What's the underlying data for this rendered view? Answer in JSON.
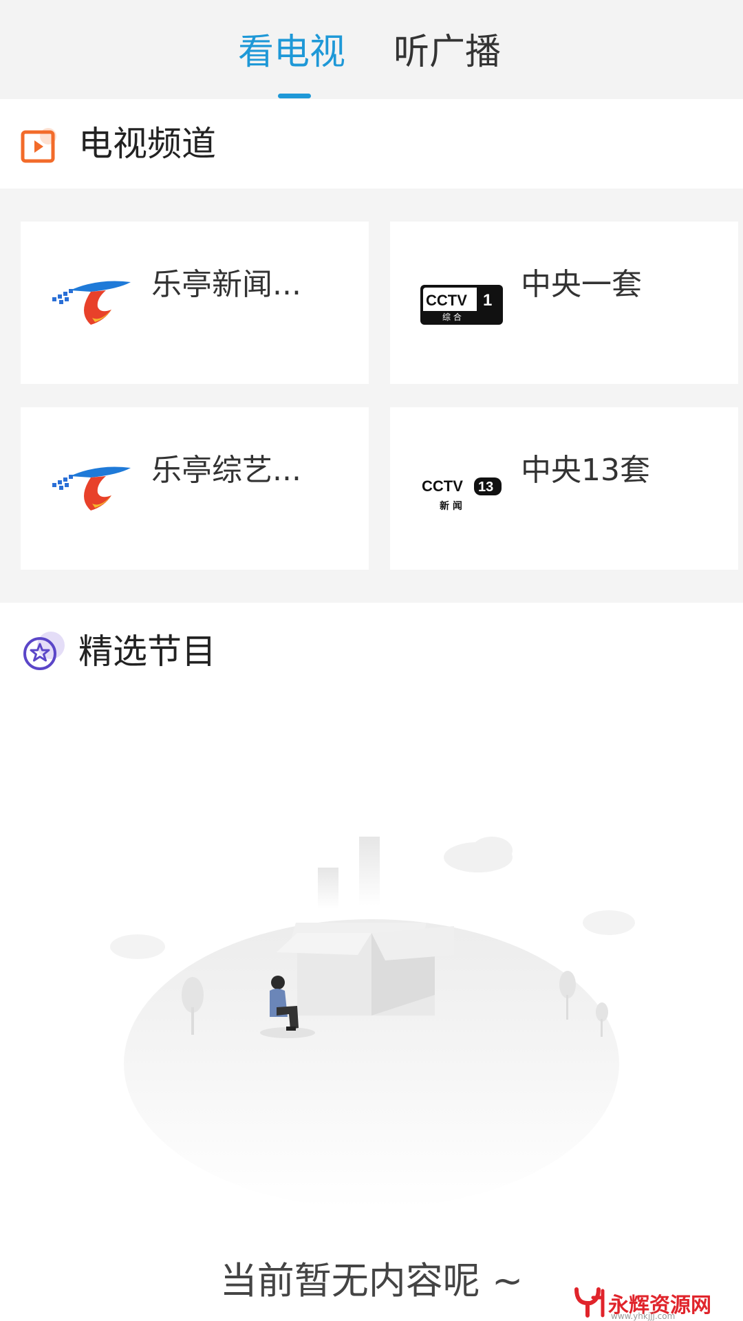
{
  "tabs": [
    {
      "label": "看电视",
      "active": true
    },
    {
      "label": "听广播",
      "active": false
    }
  ],
  "colors": {
    "accent": "#1e98d7",
    "tv_icon": "#f26b2a",
    "star_icon": "#5b46c8",
    "brand_red": "#e0242b"
  },
  "tv_section": {
    "title": "电视频道",
    "icon": "play-box-icon"
  },
  "channels": [
    {
      "name": "乐亭新闻...",
      "logo": "leting-tv-logo"
    },
    {
      "name": "中央一套",
      "logo": "cctv1-logo",
      "logo_text": "CCTV",
      "logo_num": "1",
      "logo_sub": "综 合"
    },
    {
      "name": "乐亭综艺...",
      "logo": "leting-tv-logo"
    },
    {
      "name": "中央13套",
      "logo": "cctv13-logo",
      "logo_text": "CCTV",
      "logo_num": "13",
      "logo_sub": "新 闻"
    }
  ],
  "program_section": {
    "title": "精选节目",
    "icon": "star-circle-icon"
  },
  "empty_state": {
    "message": "当前暂无内容呢 ~"
  },
  "watermark": {
    "text": "永辉资源网",
    "url": "www.yhkjjj.com"
  }
}
